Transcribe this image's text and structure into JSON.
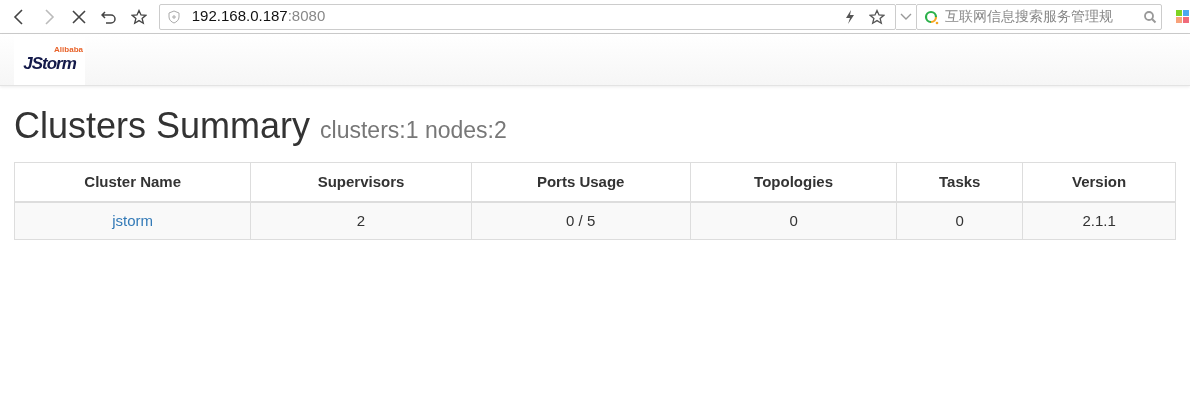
{
  "browser": {
    "address_host": "192.168.0.187",
    "address_port": ":8080",
    "loading": true,
    "search_placeholder": "互联网信息搜索服务管理规"
  },
  "navbar": {
    "logo_text": "JStorm",
    "logo_tag": "Alibaba"
  },
  "heading": {
    "title": "Clusters Summary",
    "subtitle": "clusters:1 nodes:2"
  },
  "table": {
    "columns": [
      "Cluster Name",
      "Supervisors",
      "Ports Usage",
      "Topologies",
      "Tasks",
      "Version"
    ],
    "rows": [
      {
        "cells": [
          "jstorm",
          "2",
          "0 / 5",
          "0",
          "0",
          "2.1.1"
        ]
      }
    ]
  }
}
